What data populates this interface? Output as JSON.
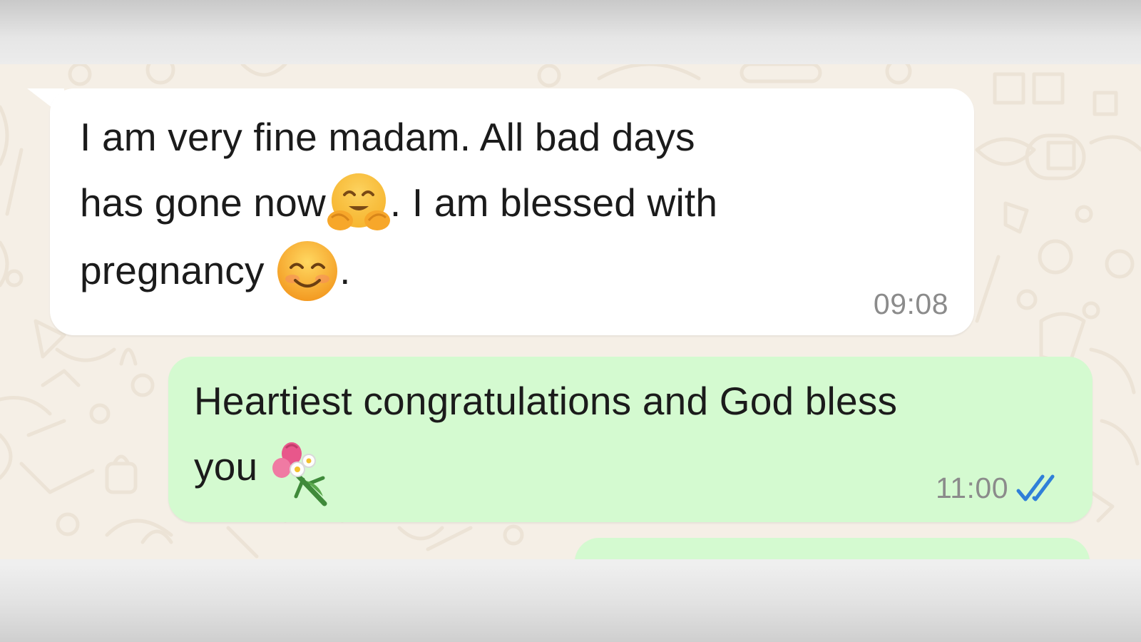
{
  "messages": [
    {
      "direction": "incoming",
      "line1": "I am very fine madam. All bad days",
      "line2_before_emoji": "has gone now",
      "line2_emoji": "hugging-face-emoji",
      "line2_after_emoji": ". I am blessed with",
      "line3_before_emoji": "pregnancy ",
      "line3_emoji": "smiling-face-with-smiling-eyes-emoji",
      "line3_after_emoji": ".",
      "time": "09:08"
    },
    {
      "direction": "outgoing",
      "line1": "Heartiest congratulations and God bless",
      "line2_before_emoji": "you ",
      "line2_emoji": "bouquet-emoji",
      "time": "11:00",
      "status": "read-double-tick-icon"
    }
  ],
  "colors": {
    "chat_background": "#f5efe6",
    "incoming_bubble": "#ffffff",
    "outgoing_bubble": "#d4fad0",
    "read_ticks": "#2f7fd8",
    "timestamp": "#8b8b8b"
  }
}
